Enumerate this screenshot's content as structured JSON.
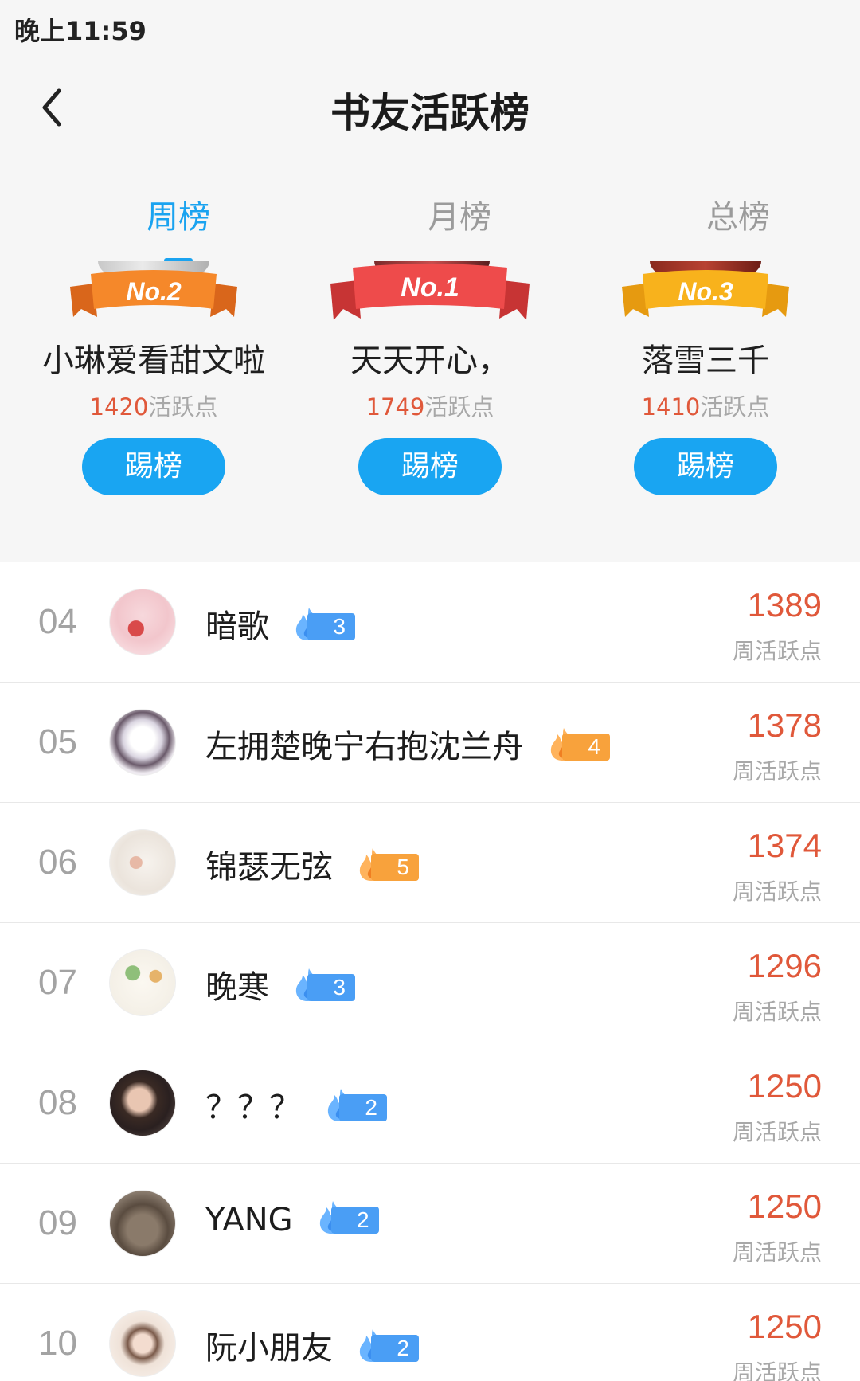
{
  "status_bar": {
    "time": "晚上11:59"
  },
  "header": {
    "title": "书友活跃榜"
  },
  "tabs": [
    {
      "label": "周榜",
      "active": true
    },
    {
      "label": "月榜",
      "active": false
    },
    {
      "label": "总榜",
      "active": false
    }
  ],
  "podium": [
    {
      "place": "No.2",
      "name": "小琳爱看甜文啦",
      "points": "1420",
      "points_suffix": "活跃点",
      "button": "踢榜",
      "ribbon_color": "#f5882a"
    },
    {
      "place": "No.1",
      "name": "天天开心，",
      "points": "1749",
      "points_suffix": "活跃点",
      "button": "踢榜",
      "ribbon_color": "#ee4b4b"
    },
    {
      "place": "No.3",
      "name": "落雪三千",
      "points": "1410",
      "points_suffix": "活跃点",
      "button": "踢榜",
      "ribbon_color": "#f8b21c"
    }
  ],
  "list": [
    {
      "rank": "04",
      "name": "暗歌",
      "level": "3",
      "badge_color": "blue",
      "score": "1389",
      "score_label": "周活跃点"
    },
    {
      "rank": "05",
      "name": "左拥楚晚宁右抱沈兰舟",
      "level": "4",
      "badge_color": "orange",
      "score": "1378",
      "score_label": "周活跃点"
    },
    {
      "rank": "06",
      "name": "锦瑟无弦",
      "level": "5",
      "badge_color": "orange",
      "score": "1374",
      "score_label": "周活跃点"
    },
    {
      "rank": "07",
      "name": "晚寒",
      "level": "3",
      "badge_color": "blue",
      "score": "1296",
      "score_label": "周活跃点"
    },
    {
      "rank": "08",
      "name": "？？？",
      "level": "2",
      "badge_color": "blue",
      "score": "1250",
      "score_label": "周活跃点"
    },
    {
      "rank": "09",
      "name": "YANG",
      "level": "2",
      "badge_color": "blue",
      "score": "1250",
      "score_label": "周活跃点"
    },
    {
      "rank": "10",
      "name": "阮小朋友",
      "level": "2",
      "badge_color": "blue",
      "score": "1250",
      "score_label": "周活跃点"
    }
  ],
  "colors": {
    "accent": "#1aa3f0",
    "score": "#e0583a",
    "badge_blue": "#4a9ef5",
    "badge_orange": "#f8a23c"
  }
}
